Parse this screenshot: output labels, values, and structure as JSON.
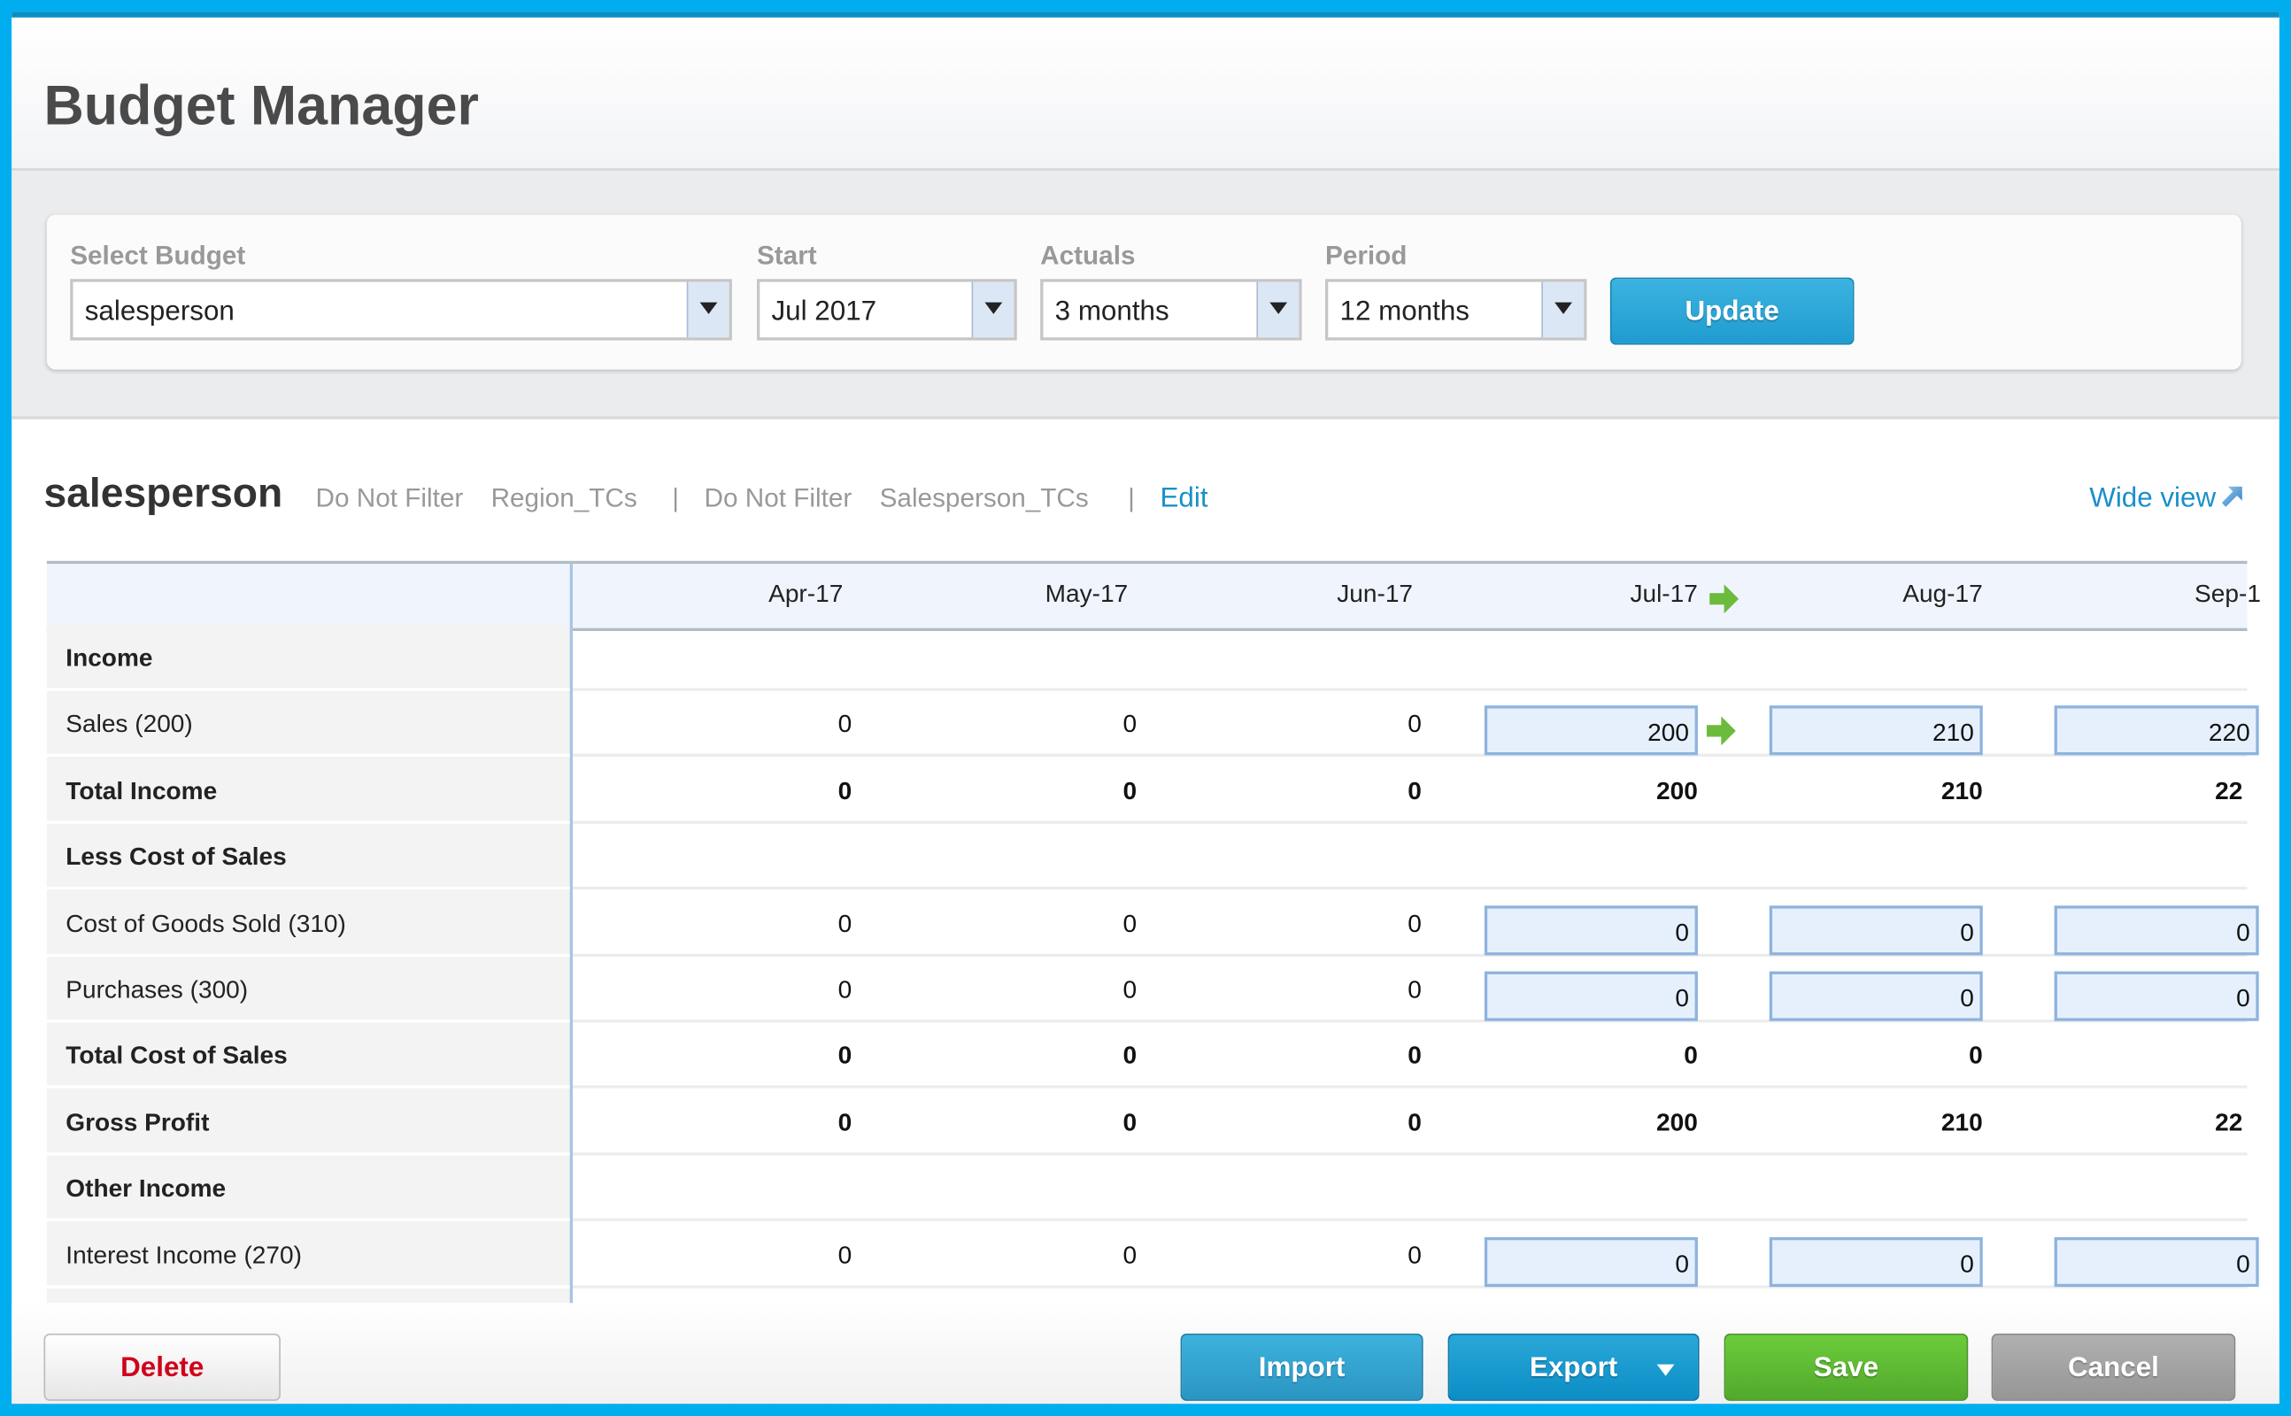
{
  "header": {
    "title": "Budget Manager"
  },
  "filters": {
    "select_budget": {
      "label": "Select Budget",
      "value": "salesperson"
    },
    "start": {
      "label": "Start",
      "value": "Jul 2017"
    },
    "actuals": {
      "label": "Actuals",
      "value": "3 months"
    },
    "period": {
      "label": "Period",
      "value": "12 months"
    },
    "update_label": "Update"
  },
  "budget": {
    "name": "salesperson",
    "filter1": "Do Not Filter",
    "filter1_cat": "Region_TCs",
    "sep": "|",
    "filter2": "Do Not Filter",
    "filter2_cat": "Salesperson_TCs",
    "edit_label": "Edit",
    "wide_view_label": "Wide view"
  },
  "table": {
    "months": [
      "Apr-17",
      "May-17",
      "Jun-17",
      "Jul-17",
      "Aug-17",
      "Sep-1"
    ],
    "rows": [
      {
        "label": "Income",
        "bold": true,
        "values": []
      },
      {
        "label": "Sales (200)",
        "bold": false,
        "values": [
          "0",
          "0",
          "0",
          "200",
          "210",
          "220"
        ],
        "editable": true
      },
      {
        "label": "Total Income",
        "bold": true,
        "values": [
          "0",
          "0",
          "0",
          "200",
          "210",
          "22"
        ]
      },
      {
        "label": "Less Cost of Sales",
        "bold": true,
        "values": []
      },
      {
        "label": "Cost of Goods Sold (310)",
        "bold": false,
        "values": [
          "0",
          "0",
          "0",
          "0",
          "0",
          "0"
        ],
        "editable": true
      },
      {
        "label": "Purchases (300)",
        "bold": false,
        "values": [
          "0",
          "0",
          "0",
          "0",
          "0",
          "0"
        ],
        "editable": true
      },
      {
        "label": "Total Cost of Sales",
        "bold": true,
        "values": [
          "0",
          "0",
          "0",
          "0",
          "0",
          ""
        ]
      },
      {
        "label": "Gross Profit",
        "bold": true,
        "values": [
          "0",
          "0",
          "0",
          "200",
          "210",
          "22"
        ]
      },
      {
        "label": "Other Income",
        "bold": true,
        "values": []
      },
      {
        "label": "Interest Income (270)",
        "bold": false,
        "values": [
          "0",
          "0",
          "0",
          "0",
          "0",
          "0"
        ],
        "editable": true
      }
    ]
  },
  "footer": {
    "delete": "Delete",
    "import": "Import",
    "export": "Export",
    "save": "Save",
    "cancel": "Cancel"
  },
  "colors": {
    "accent": "#00aeef",
    "link": "#1a8fc9",
    "save": "#5bbd32",
    "delete_text": "#d0021b"
  }
}
